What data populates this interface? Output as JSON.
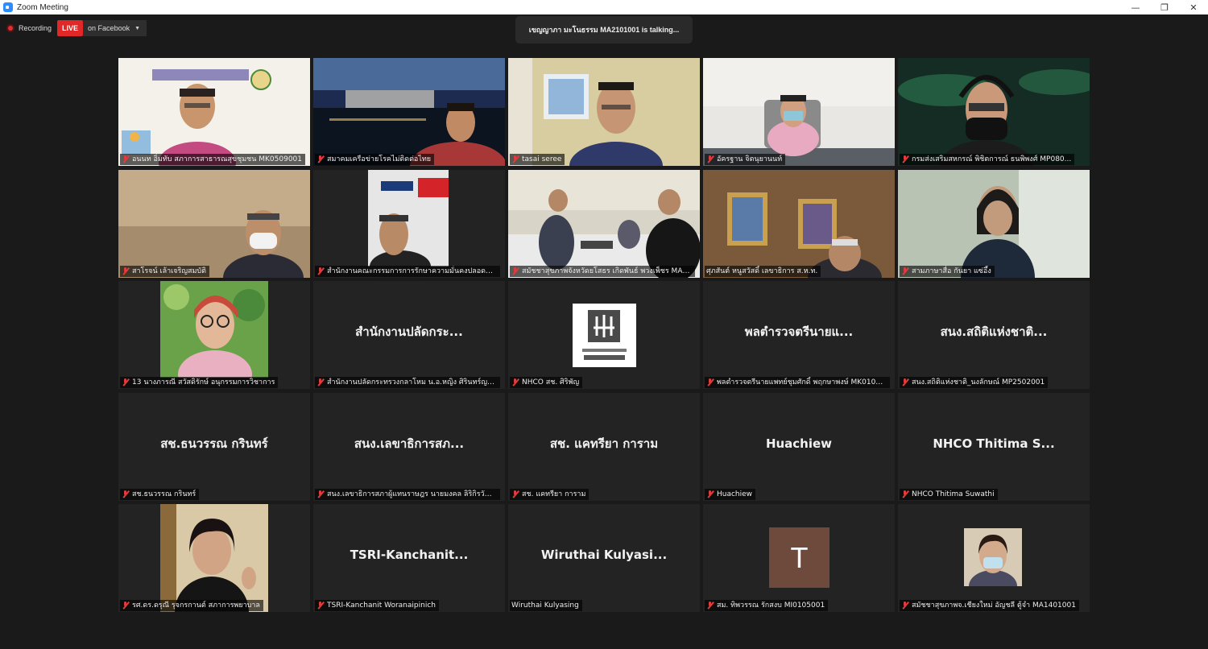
{
  "window": {
    "title": "Zoom Meeting",
    "controls": [
      "—",
      "❐",
      "✕"
    ]
  },
  "recording": {
    "label": "Recording",
    "live": "LIVE",
    "target": "on Facebook"
  },
  "speaker": {
    "text": "เขญญาภา มะโนธรรม MA2101001  is  talking..."
  },
  "tiles": [
    {
      "name": "อนนท อิ่มทับ สภาการสาธารณสุขชุมชน MK0509001",
      "display": "",
      "muted": true
    },
    {
      "name": "สมาคมเครือข่ายโรคไม่ติดต่อไทย",
      "display": "",
      "muted": true
    },
    {
      "name": "tasai seree",
      "display": "",
      "muted": true
    },
    {
      "name": "อัครฐาน จิตนุยานนท์",
      "display": "",
      "muted": true
    },
    {
      "name": "กรมส่งเสริมสหกรณ์ พิชิตการณ์ ธนพิพงศ์ MP080...",
      "display": "",
      "muted": true
    },
    {
      "name": "สาโรจน์ เล้าเจริญสมบัติ",
      "display": "",
      "muted": true
    },
    {
      "name": "สำนักงานคณะกรรมการการรักษาความมั่นคงปลอดภัยไซ...",
      "display": "",
      "muted": true
    },
    {
      "name": "สมัชชาสุขภาพจังหวัดยโสธร เกิดพันธ์ พวงเพ็ชร MA4...",
      "display": "",
      "muted": true
    },
    {
      "name": "ศุภสันต์ หนูสวัสดิ์ เลขาธิการ ส.ห.ท.",
      "display": "",
      "muted": false
    },
    {
      "name": "สามภาษาสื่อ กันยา แซ่อึ้ง",
      "display": "",
      "muted": true
    },
    {
      "name": "13 นางภารณี สวัสดิรักษ์ อนุกรรมการวิชาการ",
      "display": "",
      "muted": true
    },
    {
      "name": "สำนักงานปลัดกระทรวงกลาโหม น.อ.หญิง ศิรินทร์ญา เ...",
      "display": "สำนักงานปลัดกระ...",
      "muted": true
    },
    {
      "name": "NHCO สช. ศิริพัญ",
      "display": "",
      "muted": true
    },
    {
      "name": "พลตำรวจตรีนายแพทย์ชุมศักดิ์ พฤกษาพงษ์ MK01020...",
      "display": "พลตำรวจตรีนายแ...",
      "muted": true
    },
    {
      "name": "สนง.สถิติแห่งชาติ_นงลักษณ์ MP2502001",
      "display": "สนง.สถิติแห่งชาติ...",
      "muted": true
    },
    {
      "name": "สช.ธนวรรณ กรินทร์",
      "display": "สช.ธนวรรณ กรินทร์",
      "muted": true
    },
    {
      "name": "สนง.เลขาธิการสภาผู้แทนราษฎร นายมงคล ลิริกิรวัฒน์ ...",
      "display": "สนง.เลขาธิการสภ...",
      "muted": true
    },
    {
      "name": "สช. แคทรียา การาม",
      "display": "สช. แคทรียา การาม",
      "muted": true
    },
    {
      "name": "Huachiew",
      "display": "Huachiew",
      "muted": true
    },
    {
      "name": "NHCO Thitima Suwathi",
      "display": "NHCO Thitima S...",
      "muted": true
    },
    {
      "name": "รศ.ดร.ดรุณี รุจกรกานต์ สภาการพยาบาล",
      "display": "",
      "muted": true
    },
    {
      "name": "TSRI-Kanchanit Woranaipinich",
      "display": "TSRI-Kanchanit...",
      "muted": true
    },
    {
      "name": "Wiruthai Kulyasing",
      "display": "Wiruthai  Kulyasi...",
      "muted": false
    },
    {
      "name": "สม. ทิพวรรณ รักสงบ MI0105001",
      "display": "",
      "avatar": "T",
      "muted": true
    },
    {
      "name": "สมัชชาสุขภาพจ.เชียงใหม่ อัญชลี ตู้จำ MA1401001",
      "display": "",
      "muted": true
    }
  ],
  "colors": {
    "accent": "#2d8cff",
    "live": "#e02828",
    "muted": "#e23b3b",
    "tile_bg": "#232323"
  },
  "icons": {
    "app": "zoom-icon",
    "record": "record-dot-icon",
    "mic": "mic-off-icon",
    "logo": "nhco-logo"
  }
}
